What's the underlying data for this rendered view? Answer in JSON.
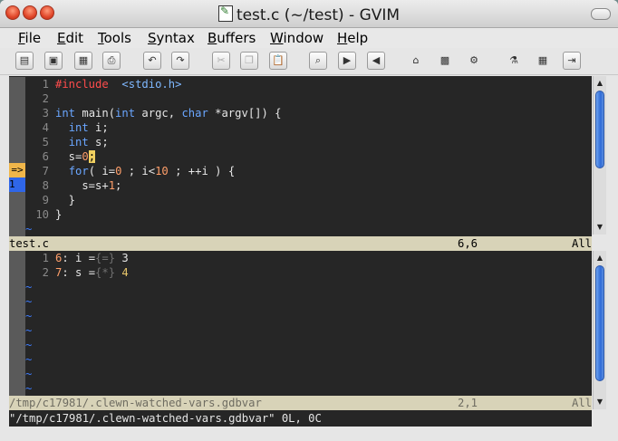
{
  "window": {
    "title": "test.c (~/test) - GVIM",
    "icons": [
      "close-button",
      "minimize-button",
      "maximize-button",
      "gvim-file-icon"
    ]
  },
  "menubar": {
    "items": [
      {
        "label": "File",
        "u": "F",
        "rest": "ile"
      },
      {
        "label": "Edit",
        "u": "E",
        "rest": "dit"
      },
      {
        "label": "Tools",
        "u": "T",
        "rest": "ools"
      },
      {
        "label": "Syntax",
        "u": "S",
        "rest": "yntax"
      },
      {
        "label": "Buffers",
        "u": "B",
        "rest": "uffers"
      },
      {
        "label": "Window",
        "u": "W",
        "rest": "indow"
      },
      {
        "label": "Help",
        "u": "H",
        "rest": "elp"
      }
    ]
  },
  "toolbar": {
    "buttons": [
      "open-icon",
      "save-icon",
      "save-all-icon",
      "print-icon",
      "undo-icon",
      "redo-icon",
      "cut-icon",
      "copy-icon",
      "paste-icon",
      "find-replace-icon",
      "find-next-icon",
      "find-prev-icon",
      "load-session-icon",
      "save-session-icon",
      "run-script-icon",
      "make-icon",
      "run-ctags-icon",
      "jump-to-tag-icon"
    ]
  },
  "editor": {
    "top_pane": {
      "lines": [
        {
          "n": "1",
          "tokens": [
            {
              "t": "#include",
              "c": "pp"
            },
            {
              "t": "  "
            },
            {
              "t": "<stdio.h>",
              "c": "str"
            }
          ]
        },
        {
          "n": "2",
          "tokens": []
        },
        {
          "n": "3",
          "tokens": [
            {
              "t": "int",
              "c": "kw"
            },
            {
              "t": " main("
            },
            {
              "t": "int",
              "c": "kw"
            },
            {
              "t": " argc, "
            },
            {
              "t": "char",
              "c": "kw"
            },
            {
              "t": " *argv[]) {"
            }
          ]
        },
        {
          "n": "4",
          "tokens": [
            {
              "t": "  "
            },
            {
              "t": "int",
              "c": "kw"
            },
            {
              "t": " i;"
            }
          ]
        },
        {
          "n": "5",
          "tokens": [
            {
              "t": "  "
            },
            {
              "t": "int",
              "c": "kw"
            },
            {
              "t": " s;"
            }
          ]
        },
        {
          "n": "6",
          "tokens": [
            {
              "t": "  s="
            },
            {
              "t": "0",
              "c": "num"
            },
            {
              "t": ";",
              "c": "cursor"
            }
          ]
        },
        {
          "n": "7",
          "tokens": [
            {
              "t": "  "
            },
            {
              "t": "for",
              "c": "kw"
            },
            {
              "t": "( i="
            },
            {
              "t": "0",
              "c": "num"
            },
            {
              "t": " ; i<"
            },
            {
              "t": "10",
              "c": "num"
            },
            {
              "t": " ; ++i ) {"
            }
          ]
        },
        {
          "n": "8",
          "tokens": [
            {
              "t": "    s=s+"
            },
            {
              "t": "1",
              "c": "num"
            },
            {
              "t": ";"
            }
          ]
        },
        {
          "n": "9",
          "tokens": [
            {
              "t": "  }"
            }
          ]
        },
        {
          "n": "10",
          "tokens": [
            {
              "t": "}"
            }
          ]
        }
      ],
      "sign_arrow": "=>",
      "sign_breakpoint": "1",
      "tilde": "~",
      "status": {
        "name": "test.c",
        "pos": "6,6",
        "scroll": "All"
      }
    },
    "bottom_pane": {
      "lines": [
        {
          "n": "1",
          "tokens": [
            {
              "t": "6",
              "c": "num"
            },
            {
              "t": ": i ="
            },
            {
              "t": "{=}",
              "c": "dim"
            },
            {
              "t": " 3"
            }
          ]
        },
        {
          "n": "2",
          "tokens": [
            {
              "t": "7",
              "c": "num"
            },
            {
              "t": ": s ="
            },
            {
              "t": "{*}",
              "c": "dim"
            },
            {
              "t": " "
            },
            {
              "t": "4",
              "c": "yl"
            }
          ]
        }
      ],
      "tilde": "~",
      "status": {
        "name": "/tmp/c17981/.clewn-watched-vars.gdbvar",
        "pos": "2,1",
        "scroll": "All"
      }
    },
    "cmdline": "\"/tmp/c17981/.clewn-watched-vars.gdbvar\" 0L, 0C"
  }
}
